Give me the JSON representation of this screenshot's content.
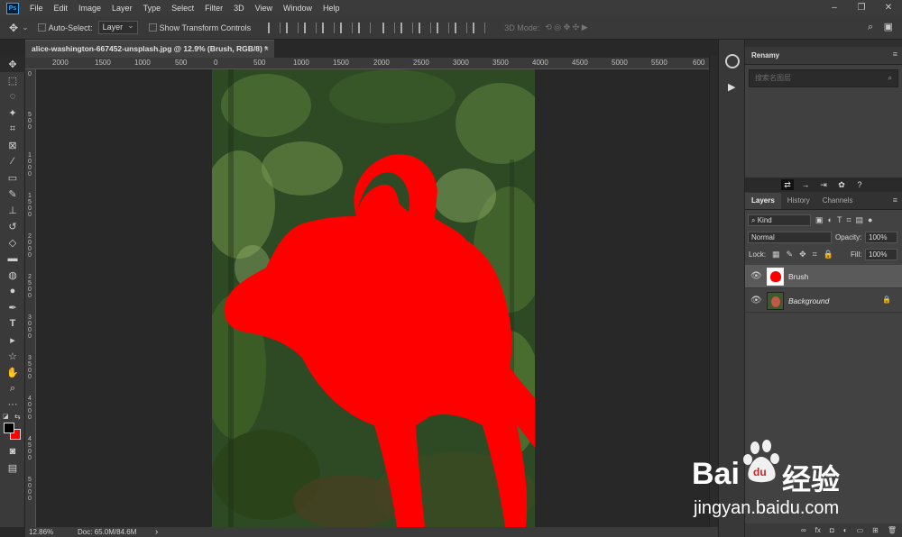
{
  "menu": {
    "logo": "Ps",
    "items": [
      "File",
      "Edit",
      "Image",
      "Layer",
      "Type",
      "Select",
      "Filter",
      "3D",
      "View",
      "Window",
      "Help"
    ]
  },
  "options": {
    "auto_select_label": "Auto-Select:",
    "auto_select_value": "Layer",
    "transform_label": "Show Transform Controls",
    "mode3d_label": "3D Mode:"
  },
  "document": {
    "tab_title": "alice-washington-667452-unsplash.jpg @ 12.9% (Brush, RGB/8) *",
    "close": "×"
  },
  "ruler": {
    "top_ticks": [
      "2000",
      "1500",
      "1000",
      "500",
      "0",
      "500",
      "1000",
      "1500",
      "2000",
      "2500",
      "3000",
      "3500",
      "4000",
      "4500",
      "5000",
      "5500",
      "600"
    ],
    "left_ticks": [
      "0",
      "5\n0\n0",
      "1\n0\n0\n0",
      "1\n5\n0\n0",
      "2\n0\n0\n0",
      "2\n5\n0\n0",
      "3\n0\n0\n0",
      "3\n5\n0\n0",
      "4\n0\n0\n0",
      "4\n5\n0\n0",
      "5\n0\n0\n0"
    ]
  },
  "status": {
    "zoom": "12.86%",
    "doc": "Doc: 65.0M/84.6M",
    "arrow": "›"
  },
  "renamy": {
    "title": "Renamy",
    "search_placeholder": "搜索名图层"
  },
  "layers_panel": {
    "tabs": [
      "Layers",
      "History",
      "Channels"
    ],
    "kind_label": "Kind",
    "blend_mode": "Normal",
    "opacity_label": "Opacity:",
    "opacity_value": "100%",
    "lock_label": "Lock:",
    "fill_label": "Fill:",
    "fill_value": "100%",
    "layers": [
      {
        "name": "Brush",
        "selected": true,
        "locked": false
      },
      {
        "name": "Background",
        "selected": false,
        "locked": true
      }
    ],
    "footer": [
      "∞",
      "fx",
      "◘",
      "◐",
      "▭",
      "⊞",
      "🗑"
    ]
  },
  "watermark": {
    "brand": "Bai",
    "brand2": "经验",
    "du": "du",
    "url": "jingyan.baidu.com"
  },
  "colors": {
    "foreground": "#000000",
    "background": "#ff0000",
    "brush": "#ff0000"
  }
}
